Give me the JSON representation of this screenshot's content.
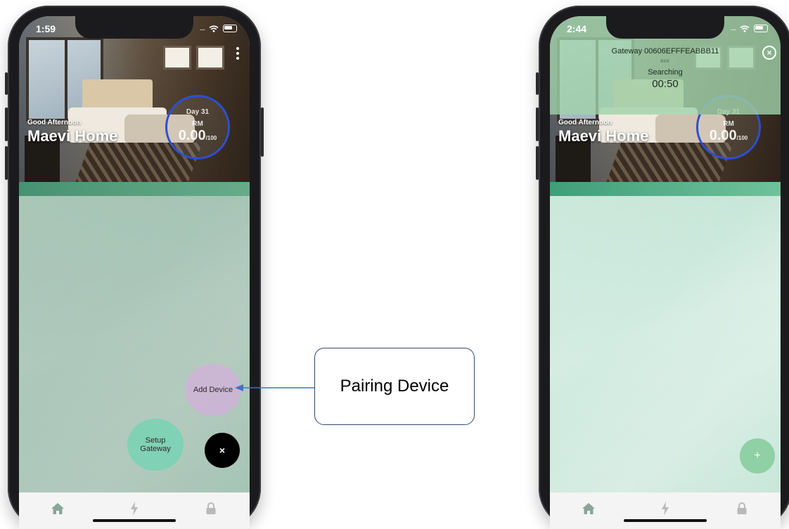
{
  "left_phone": {
    "status": {
      "time": "1:59"
    },
    "hero": {
      "greeting": "Good Afternoon",
      "home_name": "Maevi Home",
      "day": "Day 31",
      "currency": "RM",
      "amount": "0.00",
      "limit": "/100"
    },
    "fab_menu": {
      "add_device": "Add Device",
      "setup_gateway": "Setup Gateway",
      "close": "×"
    }
  },
  "right_phone": {
    "status": {
      "time": "2:44"
    },
    "gateway_banner": {
      "title": "Gateway 00606EFFFEABBB11",
      "bars": "IIIII",
      "searching": "Searching",
      "timer": "00:50",
      "close": "×"
    },
    "hero": {
      "greeting": "Good Afternoon",
      "home_name": "Maevi Home",
      "day": "Day 31",
      "currency": "RM",
      "amount": "0.00",
      "limit": "/100"
    },
    "fab_add": "+"
  },
  "annotation": {
    "label": "Pairing Device"
  },
  "tabbar_icons": [
    "home-icon",
    "energy-icon",
    "lock-icon"
  ],
  "colors": {
    "accent_green": "#6fc29b",
    "gauge_blue": "#2d4fd1",
    "add_device_purple": "#cdb4d6",
    "setup_gateway_teal": "#78d2b4",
    "arrow_blue": "#4472c4"
  }
}
